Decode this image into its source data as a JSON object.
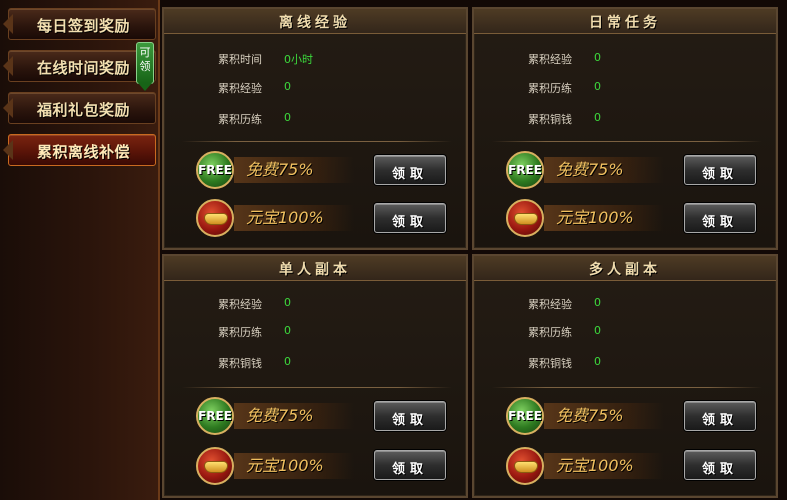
{
  "sidebar": {
    "items": [
      {
        "label": "每日签到奖励"
      },
      {
        "label": "在线时间奖励",
        "badge": "可领"
      },
      {
        "label": "福利礼包奖励"
      },
      {
        "label": "累积离线补偿",
        "active": true
      }
    ]
  },
  "panels": [
    {
      "title": "离线经验",
      "stats": [
        {
          "label": "累积时间",
          "value": "0小时"
        },
        {
          "label": "累积经验",
          "value": "0"
        },
        {
          "label": "累积历练",
          "value": "0"
        }
      ],
      "rewards": [
        {
          "icon": "FREE",
          "label": "免费75%",
          "button": "领取"
        },
        {
          "icon": "ingot-icon",
          "label": "元宝100%",
          "button": "领取"
        }
      ]
    },
    {
      "title": "日常任务",
      "stats": [
        {
          "label": "累积经验",
          "value": "0"
        },
        {
          "label": "累积历练",
          "value": "0"
        },
        {
          "label": "累积铜钱",
          "value": "0"
        }
      ],
      "rewards": [
        {
          "icon": "FREE",
          "label": "免费75%",
          "button": "领取"
        },
        {
          "icon": "ingot-icon",
          "label": "元宝100%",
          "button": "领取"
        }
      ]
    },
    {
      "title": "单人副本",
      "stats": [
        {
          "label": "累积经验",
          "value": "0"
        },
        {
          "label": "累积历练",
          "value": "0"
        },
        {
          "label": "累积铜钱",
          "value": "0"
        }
      ],
      "rewards": [
        {
          "icon": "FREE",
          "label": "免费75%",
          "button": "领取"
        },
        {
          "icon": "ingot-icon",
          "label": "元宝100%",
          "button": "领取"
        }
      ]
    },
    {
      "title": "多人副本",
      "stats": [
        {
          "label": "累积经验",
          "value": "0"
        },
        {
          "label": "累积历练",
          "value": "0"
        },
        {
          "label": "累积铜钱",
          "value": "0"
        }
      ],
      "rewards": [
        {
          "icon": "FREE",
          "label": "免费75%",
          "button": "领取"
        },
        {
          "icon": "ingot-icon",
          "label": "元宝100%",
          "button": "领取"
        }
      ]
    }
  ],
  "colors": {
    "accent_gold": "#f0c060",
    "value_green": "#3cd83c",
    "active_nav": "#7a2410"
  }
}
